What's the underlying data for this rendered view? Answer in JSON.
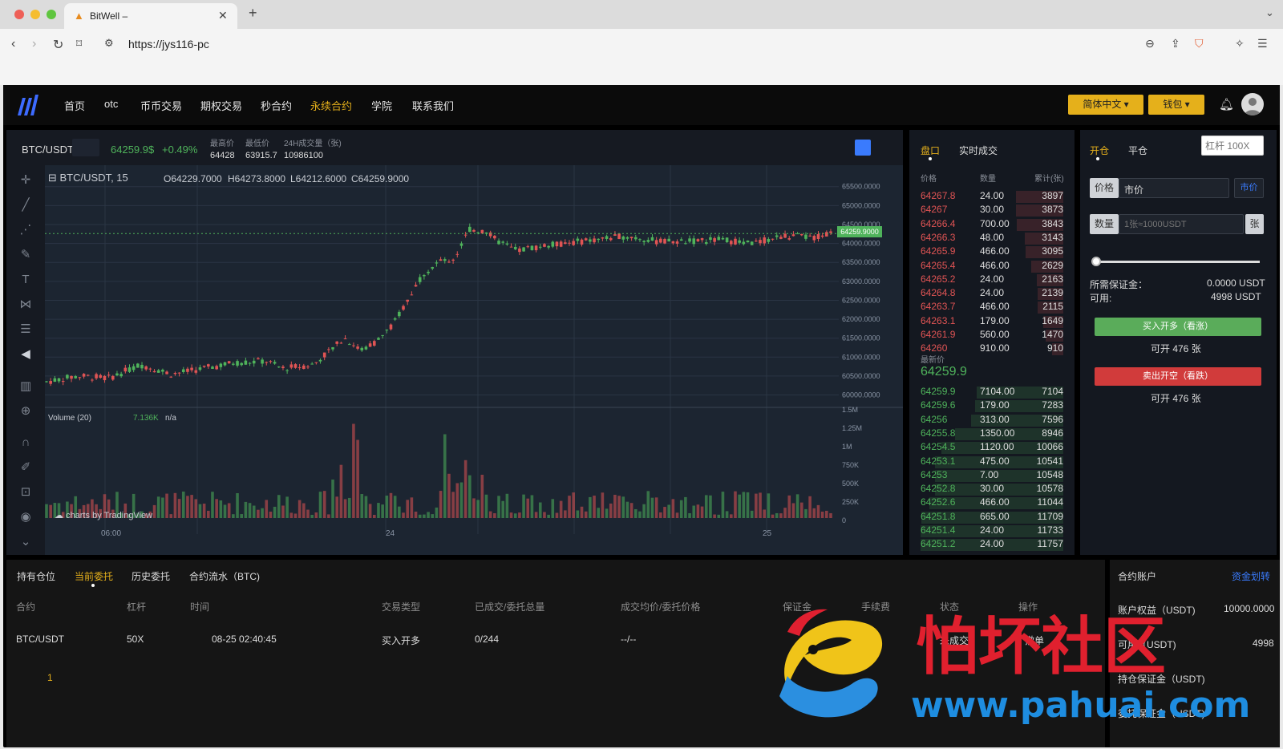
{
  "browser": {
    "tab_title": "BitWell –",
    "url": "https://jys116-pc"
  },
  "nav": {
    "items": [
      "首页",
      "otc",
      "币币交易",
      "期权交易",
      "秒合约",
      "永续合约",
      "学院",
      "联系我们"
    ],
    "active_index": 5,
    "lang_button": "简体中文",
    "wallet_button": "钱包"
  },
  "ticker": {
    "pair": "BTC/USDT",
    "price": "64259.9$",
    "change": "+0.49%",
    "high_label": "最高价",
    "high": "64428",
    "low_label": "最低价",
    "low": "63915.7",
    "vol_label": "24H成交量（张)",
    "vol": "10986100"
  },
  "chart_header": {
    "symbol": "BTC/USDT, 15",
    "o": "O64229.7000",
    "h": "H64273.8000",
    "l": "L64212.6000",
    "c": "C64259.9000",
    "last_price_tag": "64259.9000",
    "volume_label": "Volume (20)",
    "volume_value": "7.136K",
    "volume_na": "n/a",
    "watermark": "charts by TradingView"
  },
  "chart_data": {
    "type": "line",
    "price_axis": [
      "65500.0000",
      "65000.0000",
      "64500.0000",
      "64000.0000",
      "63500.0000",
      "63000.0000",
      "62500.0000",
      "62000.0000",
      "61500.0000",
      "61000.0000",
      "60500.0000",
      "60000.0000"
    ],
    "volume_axis": [
      "1.5M",
      "1.25M",
      "1M",
      "750K",
      "500K",
      "250K",
      "0"
    ],
    "time_axis": [
      "06:00",
      "24",
      "25"
    ],
    "x": [
      0,
      0.04,
      0.08,
      0.12,
      0.16,
      0.2,
      0.24,
      0.28,
      0.3,
      0.34,
      0.38,
      0.4,
      0.42,
      0.44,
      0.46,
      0.48,
      0.5,
      0.52,
      0.54,
      0.56,
      0.58,
      0.6,
      0.62,
      0.66,
      0.7,
      0.74,
      0.78,
      0.82,
      0.86,
      0.9,
      0.94,
      0.98,
      1.0
    ],
    "close": [
      60350,
      60500,
      60450,
      60800,
      60550,
      60700,
      60850,
      60900,
      60700,
      60800,
      61500,
      61200,
      61400,
      61800,
      62500,
      63200,
      63500,
      63600,
      64400,
      64300,
      64000,
      63800,
      63900,
      64000,
      64100,
      64200,
      64050,
      64050,
      64100,
      64000,
      64200,
      64150,
      64260
    ],
    "ylim": [
      59800,
      65600
    ]
  },
  "orderbook": {
    "tab_book": "盘口",
    "tab_trades": "实时成交",
    "col_price": "价格",
    "col_qty": "数量",
    "col_total": "累计(张)",
    "asks": [
      [
        "64267.8",
        "24.00",
        "3897"
      ],
      [
        "64267",
        "30.00",
        "3873"
      ],
      [
        "64266.4",
        "700.00",
        "3843"
      ],
      [
        "64266.3",
        "48.00",
        "3143"
      ],
      [
        "64265.9",
        "466.00",
        "3095"
      ],
      [
        "64265.4",
        "466.00",
        "2629"
      ],
      [
        "64265.2",
        "24.00",
        "2163"
      ],
      [
        "64264.8",
        "24.00",
        "2139"
      ],
      [
        "64263.7",
        "466.00",
        "2115"
      ],
      [
        "64263.1",
        "179.00",
        "1649"
      ],
      [
        "64261.9",
        "560.00",
        "1470"
      ],
      [
        "64260",
        "910.00",
        "910"
      ]
    ],
    "last_label": "最新价",
    "last_price": "64259.9",
    "bids": [
      [
        "64259.9",
        "7104.00",
        "7104"
      ],
      [
        "64259.6",
        "179.00",
        "7283"
      ],
      [
        "64256",
        "313.00",
        "7596"
      ],
      [
        "64255.8",
        "1350.00",
        "8946"
      ],
      [
        "64254.5",
        "1120.00",
        "10066"
      ],
      [
        "64253.1",
        "475.00",
        "10541"
      ],
      [
        "64253",
        "7.00",
        "10548"
      ],
      [
        "64252.8",
        "30.00",
        "10578"
      ],
      [
        "64252.6",
        "466.00",
        "11044"
      ],
      [
        "64251.8",
        "665.00",
        "11709"
      ],
      [
        "64251.4",
        "24.00",
        "11733"
      ],
      [
        "64251.2",
        "24.00",
        "11757"
      ]
    ]
  },
  "trade": {
    "tab_open": "开仓",
    "tab_close": "平仓",
    "leverage_placeholder": "杠杆 100X",
    "price_label": "价格",
    "price_value": "市价",
    "market_btn": "市价",
    "qty_label": "数量",
    "qty_placeholder": "1张≈1000USDT",
    "qty_unit": "张",
    "margin_label": "所需保证金：",
    "margin_value": "0.0000 USDT",
    "avail_label": "可用:",
    "avail_value": "4998 USDT",
    "buy_btn": "买入开多（看涨）",
    "buy_avail": "可开 476 张",
    "sell_btn": "卖出开空（看跌）",
    "sell_avail": "可开 476 张"
  },
  "orders": {
    "tabs": [
      "持有仓位",
      "当前委托",
      "历史委托",
      "合约流水（BTC)"
    ],
    "active_tab": 1,
    "headers": [
      "合约",
      "杠杆",
      "时间",
      "交易类型",
      "已成交/委托总量",
      "成交均价/委托价格",
      "保证金",
      "手续费",
      "状态",
      "操作"
    ],
    "row": {
      "contract": "BTC/USDT",
      "leverage": "50X",
      "time": "08-25 02:40:45",
      "type": "买入开多",
      "filled": "0/244",
      "avg_price": "--/--",
      "status": "未成交",
      "action": "撤单"
    },
    "page": "1"
  },
  "account": {
    "title": "合约账户",
    "transfer": "资金划转",
    "equity_label": "账户权益（USDT)",
    "equity": "10000.0000",
    "avail_label": "可用（USDT)",
    "avail": "4998",
    "pos_margin_label": "持仓保证金（USDT)",
    "order_margin_label": "委托保证金（USDT)"
  },
  "watermark": {
    "text_cn": "怕坏社区",
    "url": "www.pahuai.com"
  }
}
